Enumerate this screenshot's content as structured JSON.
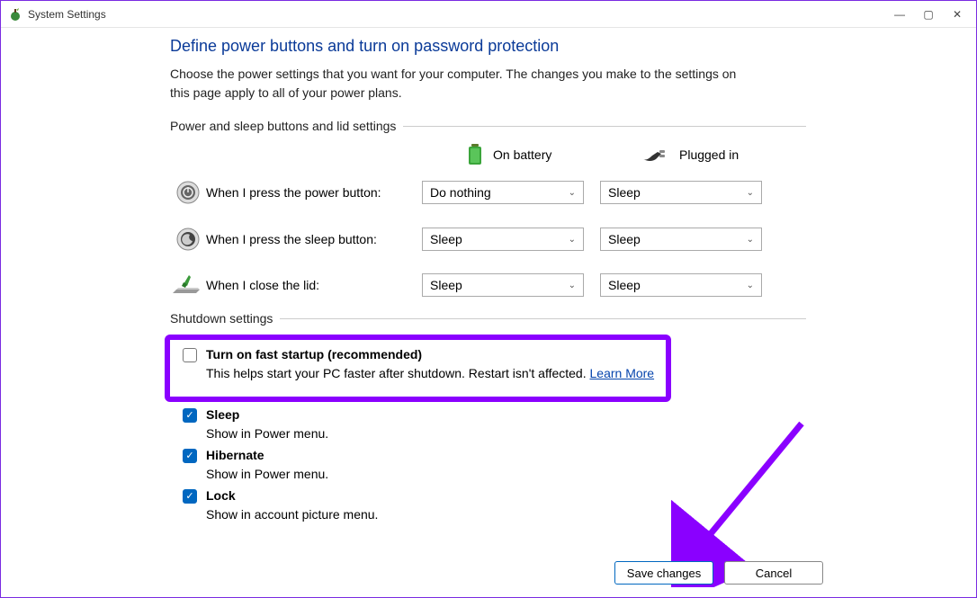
{
  "window": {
    "title": "System Settings"
  },
  "header": {
    "title": "Define power buttons and turn on password protection",
    "desc": "Choose the power settings that you want for your computer. The changes you make to the settings on this page apply to all of your power plans."
  },
  "sections": {
    "power_sleep_label": "Power and sleep buttons and lid settings",
    "shutdown_label": "Shutdown settings"
  },
  "columns": {
    "battery": "On battery",
    "plugged": "Plugged in"
  },
  "rows": {
    "power_button": {
      "label": "When I press the power button:",
      "battery": "Do nothing",
      "plugged": "Sleep"
    },
    "sleep_button": {
      "label": "When I press the sleep button:",
      "battery": "Sleep",
      "plugged": "Sleep"
    },
    "lid": {
      "label": "When I close the lid:",
      "battery": "Sleep",
      "plugged": "Sleep"
    }
  },
  "shutdown": {
    "fast_startup": {
      "label": "Turn on fast startup (recommended)",
      "desc": "This helps start your PC faster after shutdown. Restart isn't affected. ",
      "link": "Learn More"
    },
    "sleep": {
      "label": "Sleep",
      "desc": "Show in Power menu."
    },
    "hibernate": {
      "label": "Hibernate",
      "desc": "Show in Power menu."
    },
    "lock": {
      "label": "Lock",
      "desc": "Show in account picture menu."
    }
  },
  "buttons": {
    "save": "Save changes",
    "cancel": "Cancel"
  }
}
